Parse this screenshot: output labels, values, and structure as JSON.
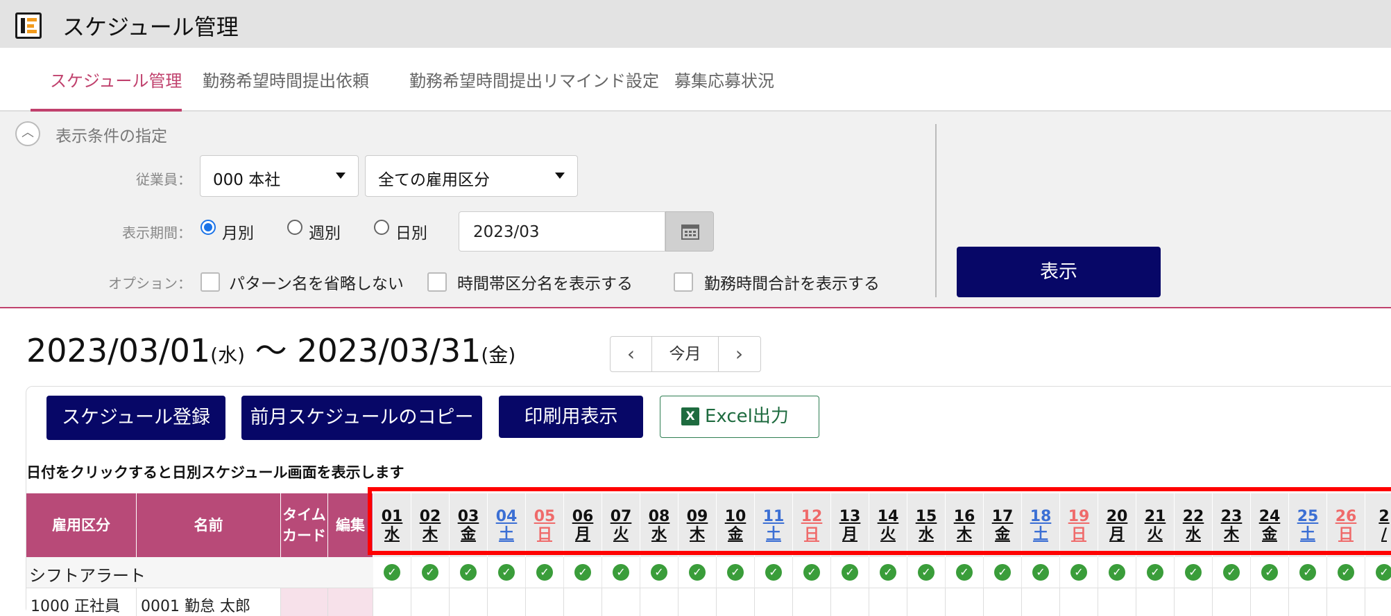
{
  "app": {
    "title": "スケジュール管理"
  },
  "tabs": [
    {
      "label": "スケジュール管理",
      "active": true
    },
    {
      "label": "勤務希望時間提出依頼"
    },
    {
      "label": "勤務希望時間提出リマインド設定"
    },
    {
      "label": "募集応募状況"
    }
  ],
  "filter": {
    "title": "表示条件の指定",
    "employee_label": "従業員：",
    "office_value": "000 本社",
    "employment_type_value": "全ての雇用区分",
    "period_label": "表示期間：",
    "period_options": [
      "月別",
      "週別",
      "日別"
    ],
    "period_selected": "月別",
    "date_value": "2023/03",
    "options_label": "オプション：",
    "options": [
      "パターン名を省略しない",
      "時間帯区分名を表示する",
      "勤務時間合計を表示する"
    ],
    "show_button": "表示"
  },
  "range": {
    "start": "2023/03/01",
    "start_dow": "(水)",
    "sep": "〜",
    "end": "2023/03/31",
    "end_dow": "(金)"
  },
  "nav": {
    "prev": "‹",
    "today": "今月",
    "next": "›"
  },
  "actions": {
    "register": "スケジュール登録",
    "copy_prev": "前月スケジュールのコピー",
    "print": "印刷用表示",
    "excel": "Excel出力"
  },
  "hint": "日付をクリックすると日別スケジュール画面を表示します",
  "table": {
    "headers": {
      "employment_type": "雇用区分",
      "name": "名前",
      "timecard": "タイムカード",
      "edit": "編集"
    },
    "days": [
      {
        "d": "01",
        "w": "水",
        "t": "wk"
      },
      {
        "d": "02",
        "w": "木",
        "t": "wk"
      },
      {
        "d": "03",
        "w": "金",
        "t": "wk"
      },
      {
        "d": "04",
        "w": "土",
        "t": "sat"
      },
      {
        "d": "05",
        "w": "日",
        "t": "sun"
      },
      {
        "d": "06",
        "w": "月",
        "t": "wk"
      },
      {
        "d": "07",
        "w": "火",
        "t": "wk"
      },
      {
        "d": "08",
        "w": "水",
        "t": "wk"
      },
      {
        "d": "09",
        "w": "木",
        "t": "wk"
      },
      {
        "d": "10",
        "w": "金",
        "t": "wk"
      },
      {
        "d": "11",
        "w": "土",
        "t": "sat"
      },
      {
        "d": "12",
        "w": "日",
        "t": "sun"
      },
      {
        "d": "13",
        "w": "月",
        "t": "wk"
      },
      {
        "d": "14",
        "w": "火",
        "t": "wk"
      },
      {
        "d": "15",
        "w": "水",
        "t": "wk"
      },
      {
        "d": "16",
        "w": "木",
        "t": "wk"
      },
      {
        "d": "17",
        "w": "金",
        "t": "wk"
      },
      {
        "d": "18",
        "w": "土",
        "t": "sat"
      },
      {
        "d": "19",
        "w": "日",
        "t": "sun"
      },
      {
        "d": "20",
        "w": "月",
        "t": "wk"
      },
      {
        "d": "21",
        "w": "火",
        "t": "wk"
      },
      {
        "d": "22",
        "w": "水",
        "t": "wk"
      },
      {
        "d": "23",
        "w": "木",
        "t": "wk"
      },
      {
        "d": "24",
        "w": "金",
        "t": "wk"
      },
      {
        "d": "25",
        "w": "土",
        "t": "sat"
      },
      {
        "d": "26",
        "w": "日",
        "t": "sun"
      },
      {
        "d": "2",
        "w": "/",
        "t": "wk"
      }
    ],
    "shift_alert_label": "シフトアラート",
    "first_row": {
      "employment_type": "1000 正社員",
      "name": "0001 勤怠 太郎"
    }
  },
  "colors": {
    "accent": "#c0416d",
    "navy": "#070767",
    "header_pink": "#b84a78",
    "saturday": "#3b6fd4",
    "sunday": "#ef6a6a",
    "highlight": "#ff0000"
  }
}
